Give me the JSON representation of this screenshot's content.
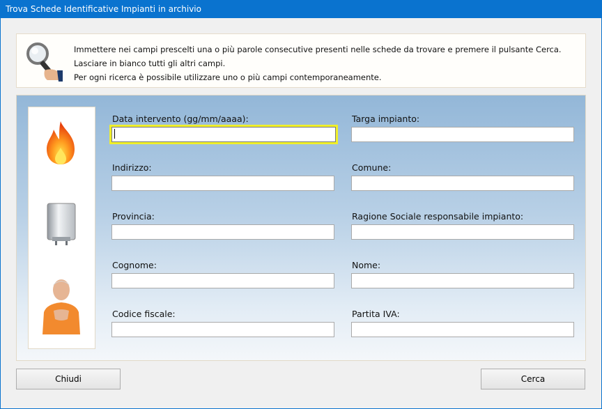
{
  "window": {
    "title": "Trova Schede Identificative Impianti in archivio"
  },
  "info": {
    "icon": "magnifier-hand-icon",
    "lines": [
      "Immettere nei campi prescelti una o più parole consecutive presenti nelle schede da trovare e premere il pulsante Cerca.",
      "Lasciare in bianco tutti gli altri campi.",
      "Per ogni ricerca è possibile utilizzare uno o più campi contemporaneamente."
    ]
  },
  "side_icons": [
    "flame-icon",
    "boiler-icon",
    "person-icon"
  ],
  "fields": {
    "data_intervento": {
      "label": "Data intervento (gg/mm/aaaa):",
      "value": ""
    },
    "targa_impianto": {
      "label": "Targa impianto:",
      "value": ""
    },
    "indirizzo": {
      "label": "Indirizzo:",
      "value": ""
    },
    "comune": {
      "label": "Comune:",
      "value": ""
    },
    "provincia": {
      "label": "Provincia:",
      "value": ""
    },
    "ragione_sociale": {
      "label": "Ragione Sociale responsabile impianto:",
      "value": ""
    },
    "cognome": {
      "label": "Cognome:",
      "value": ""
    },
    "nome": {
      "label": "Nome:",
      "value": ""
    },
    "codice_fiscale": {
      "label": "Codice fiscale:",
      "value": ""
    },
    "partita_iva": {
      "label": "Partita IVA:",
      "value": ""
    }
  },
  "buttons": {
    "close": "Chiudi",
    "search": "Cerca"
  },
  "colors": {
    "titlebar": "#0a73cf",
    "focus": "#f0ef2a",
    "panel_top": "#93b7d8"
  }
}
